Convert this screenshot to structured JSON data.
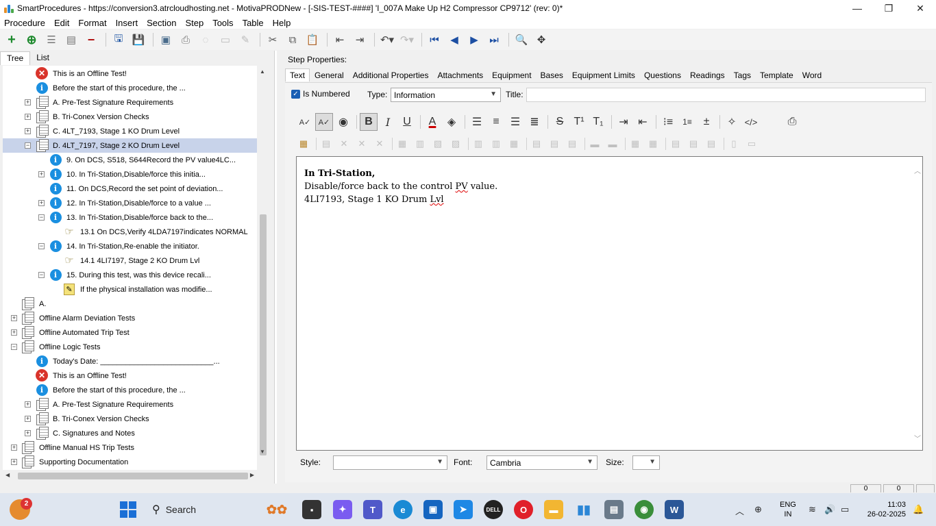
{
  "window": {
    "title": "SmartProcedures - https://conversion3.atrcloudhosting.net - MotivaPRODNew - [-SIS-TEST-####] 'I_007A Make Up H2 Compressor CP9712' (rev: 0)*",
    "minimize": "—",
    "maximize": "❐",
    "close": "✕"
  },
  "menu": [
    "Procedure",
    "Edit",
    "Format",
    "Insert",
    "Section",
    "Step",
    "Tools",
    "Table",
    "Help"
  ],
  "left_tabs": {
    "tree": "Tree",
    "list": "List"
  },
  "tree": [
    {
      "icon": "error",
      "text": "This is an Offline Test!",
      "level": 2,
      "expander": ""
    },
    {
      "icon": "info",
      "text": "Before the start of this procedure, the ...",
      "level": 2,
      "expander": ""
    },
    {
      "icon": "section",
      "text": "A. Pre-Test Signature Requirements",
      "level": 2,
      "expander": "+"
    },
    {
      "icon": "section",
      "text": "B. Tri-Conex Version Checks",
      "level": 2,
      "expander": "+"
    },
    {
      "icon": "section",
      "text": "C. 4LT_7193, Stage 1 KO Drum Level",
      "level": 2,
      "expander": "+"
    },
    {
      "icon": "section",
      "text": "D. 4LT_7197, Stage 2 KO Drum Level",
      "level": 2,
      "expander": "−",
      "selected": true
    },
    {
      "icon": "info",
      "text": "9. On DCS, S518, S644Record the PV value4LC...",
      "level": 3,
      "expander": ""
    },
    {
      "icon": "info",
      "text": "10. In Tri-Station,Disable/force this initia...",
      "level": 3,
      "expander": "+"
    },
    {
      "icon": "info",
      "text": "11. On DCS,Record the set point of deviation...",
      "level": 3,
      "expander": ""
    },
    {
      "icon": "info",
      "text": "12. In Tri-Station,Disable/force to a value ...",
      "level": 3,
      "expander": "+"
    },
    {
      "icon": "info",
      "text": "13. In Tri-Station,Disable/force back to the...",
      "level": 3,
      "expander": "−"
    },
    {
      "icon": "hand",
      "text": "13.1 On DCS,Verify 4LDA7197indicates NORMAL",
      "level": 4,
      "expander": ""
    },
    {
      "icon": "info",
      "text": "14. In Tri-Station,Re-enable the initiator.",
      "level": 3,
      "expander": "−"
    },
    {
      "icon": "hand",
      "text": "14.1 4LI7197, Stage 2 KO Drum Lvl",
      "level": 4,
      "expander": ""
    },
    {
      "icon": "info",
      "text": "15. During this test, was this device recali...",
      "level": 3,
      "expander": "−"
    },
    {
      "icon": "note",
      "text": "If the physical installation was modifie...",
      "level": 4,
      "expander": ""
    },
    {
      "icon": "section",
      "text": "A.",
      "level": 1,
      "expander": ""
    },
    {
      "icon": "section",
      "text": "Offline Alarm Deviation Tests",
      "level": 1,
      "expander": "+"
    },
    {
      "icon": "section",
      "text": "Offline Automated Trip Test",
      "level": 1,
      "expander": "+"
    },
    {
      "icon": "section",
      "text": "Offline Logic Tests",
      "level": 1,
      "expander": "−"
    },
    {
      "icon": "info",
      "text": "Today's Date: ___________________________...",
      "level": 2,
      "expander": ""
    },
    {
      "icon": "error",
      "text": "This is an Offline Test!",
      "level": 2,
      "expander": ""
    },
    {
      "icon": "info",
      "text": "Before the start of this procedure, the ...",
      "level": 2,
      "expander": ""
    },
    {
      "icon": "section",
      "text": "A. Pre-Test Signature Requirements",
      "level": 2,
      "expander": "+"
    },
    {
      "icon": "section",
      "text": "B. Tri-Conex Version Checks",
      "level": 2,
      "expander": "+"
    },
    {
      "icon": "section",
      "text": "C. Signatures and Notes",
      "level": 2,
      "expander": "+"
    },
    {
      "icon": "section",
      "text": "Offline Manual HS Trip Tests",
      "level": 1,
      "expander": "+"
    },
    {
      "icon": "section",
      "text": "Supporting Documentation",
      "level": 1,
      "expander": "+"
    }
  ],
  "step_properties": {
    "label": "Step Properties:",
    "tabs": [
      "Text",
      "General",
      "Additional Properties",
      "Attachments",
      "Equipment",
      "Bases",
      "Equipment Limits",
      "Questions",
      "Readings",
      "Tags",
      "Template",
      "Word"
    ],
    "is_numbered_label": "Is Numbered",
    "is_numbered_checked": true,
    "type_label": "Type:",
    "type_value": "Information",
    "title_label": "Title:",
    "title_value": ""
  },
  "editor": {
    "line1": "In Tri-Station,",
    "line2_a": "Disable/force back to the control ",
    "line2_b": "PV",
    "line2_c": " value.",
    "line3_a": "4LI7193, Stage 1 KO Drum ",
    "line3_b": "Lvl"
  },
  "format": {
    "style_label": "Style:",
    "style_value": "",
    "font_label": "Font:",
    "font_value": "Cambria",
    "size_label": "Size:",
    "size_value": ""
  },
  "status": {
    "cell1": "0",
    "cell2": "0"
  },
  "taskbar": {
    "notification_count": "2",
    "search_label": "Search",
    "lang_line1": "ENG",
    "lang_line2": "IN",
    "time": "11:03",
    "date": "26-02-2025"
  }
}
